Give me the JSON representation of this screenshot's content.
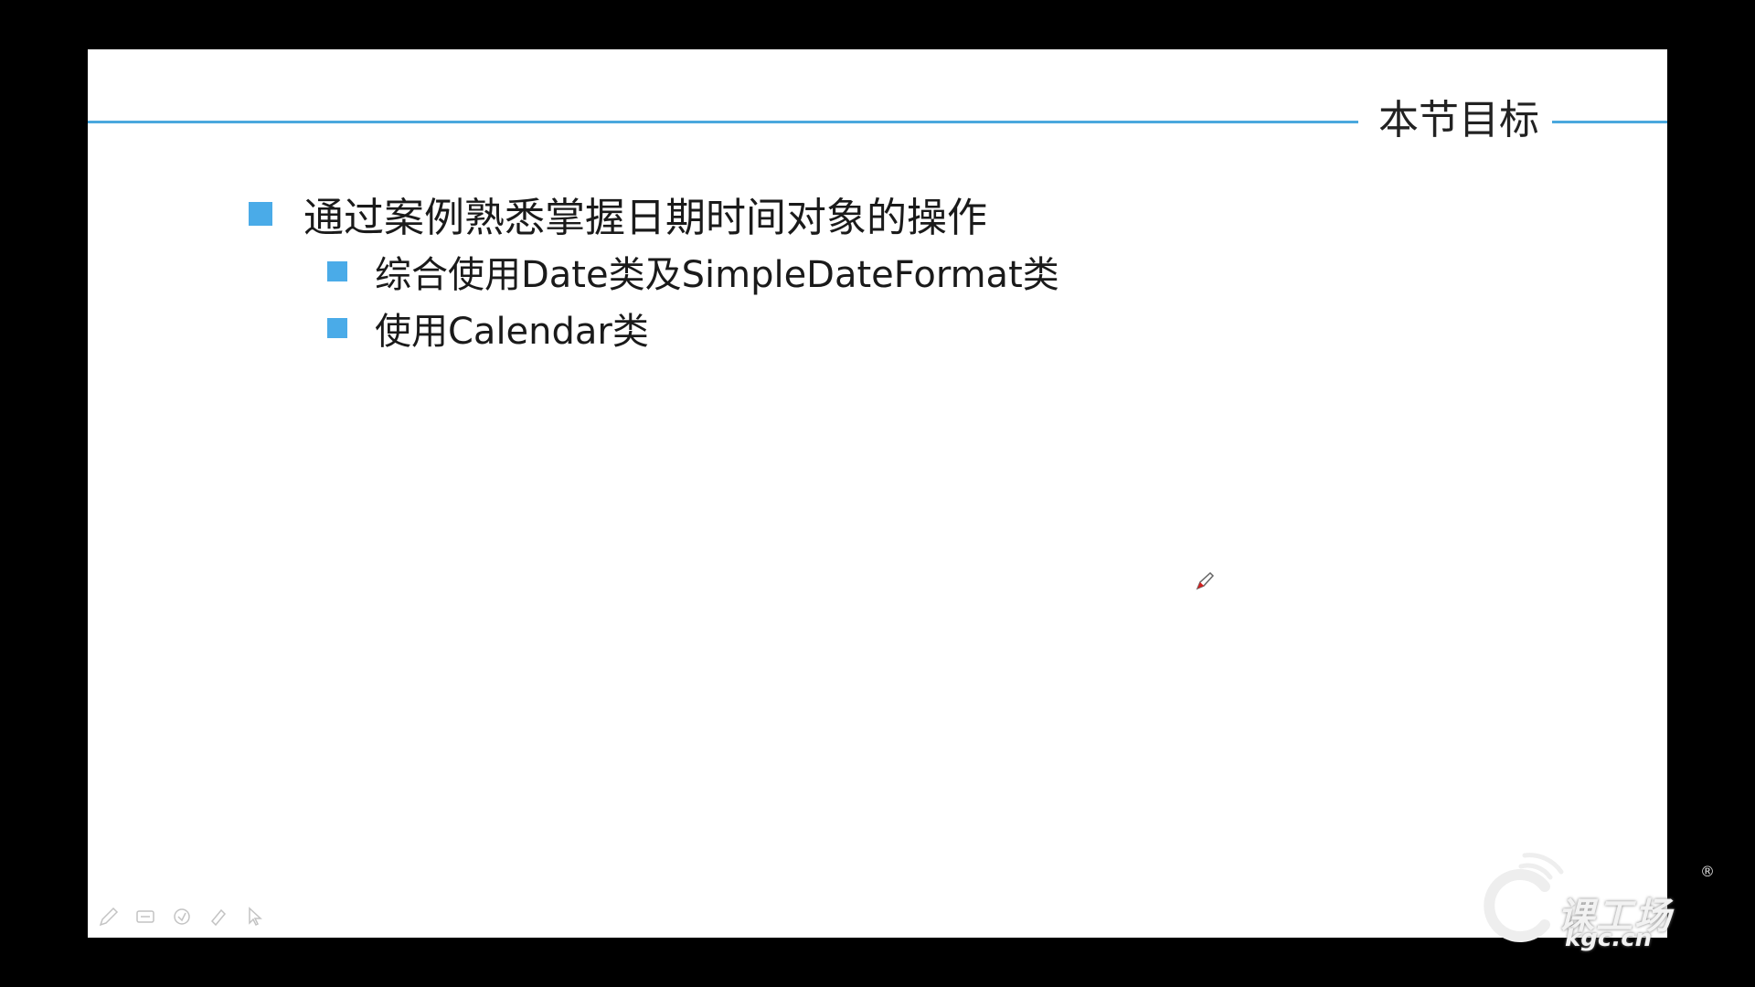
{
  "slide": {
    "title": "本节目标",
    "bullets": [
      {
        "text": "通过案例熟悉掌握日期时间对象的操作",
        "level": 1
      },
      {
        "text": "综合使用Date类及SimpleDateFormat类",
        "level": 2
      },
      {
        "text": "使用Calendar类",
        "level": 2
      }
    ]
  },
  "toolbar": {
    "icons": [
      "pen-icon",
      "highlighter-icon",
      "eraser-icon",
      "ink-icon",
      "arrow-pointer-icon"
    ]
  },
  "watermark": {
    "brand": "课工场",
    "domain": "kgc.cn",
    "registered_mark": "®"
  },
  "colors": {
    "accent": "#4aa8dd",
    "bullet": "#4aabe8",
    "background": "#000000",
    "slide": "#ffffff"
  }
}
